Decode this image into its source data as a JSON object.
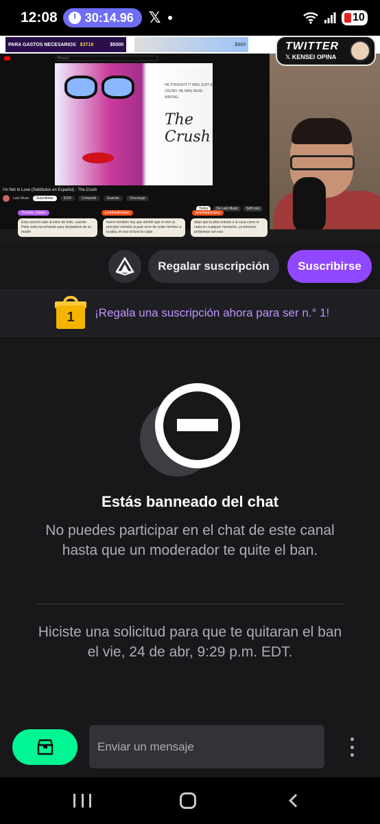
{
  "status_bar": {
    "time": "12:08",
    "timer": "30:14.96",
    "x_symbol": "𝕏",
    "battery": "10",
    "icons": [
      "stopwatch-icon",
      "x-app-icon",
      "notification-dot-icon",
      "wifi-icon",
      "signal-icon",
      "battery-icon"
    ]
  },
  "stream": {
    "ticker_left_text": "PARA GASTOS NECESARIOS",
    "ticker_left_amount": "$3719",
    "ticker_left_amount2": "$5000",
    "ticker_right_amount": "$969",
    "youtube_search_placeholder": "Buscar",
    "poster_title": "The Crush",
    "poster_tagline": "HE THOUGHT IT WAS JUST A CRUSH. HE WAS DEAD WRONG.",
    "video_title": "I'm Not In Love (Subtítulos en Español) - The Crush",
    "channel_name": "Lalo Music",
    "subscribe_label": "Suscribirse",
    "like_count": "3154",
    "share_label": "Compartir",
    "save_label": "Guardar",
    "download_label": "Descargar",
    "chips": [
      "Todos",
      "De Lalo Music",
      "Soft rock"
    ],
    "twitter_badge_title": "TWITTER",
    "twitter_badge_handle": "𝕏 KENSEI OPINA",
    "overlay_messages": [
      {
        "name": "Thunder_Elgato",
        "text": "Esta canción sale al inicio de todo, cuando Peter está escuchando para despedirse de su madre"
      },
      {
        "name": "jonathanjimojuin",
        "text": "bueno tambien hay que admitir que el men al principio cometio al gran error de ceder termino a la piba, en eso el tuvo la culpa"
      },
      {
        "name": "jonathanjimojuin",
        "text": "dejar que la piba entrara a la casa como si nada en cualquier momento, ya tenemos problemas con eso"
      }
    ]
  },
  "actions": {
    "gift_sub_label": "Regalar suscripción",
    "subscribe_label": "Suscribirse",
    "accent_color": "#9147ff"
  },
  "gift_banner": {
    "badge_number": "1",
    "text": "¡Regala una suscripción ahora para ser n.° 1!"
  },
  "ban": {
    "title": "Estás banneado del chat",
    "message": "No puedes participar en el chat de este canal hasta que un moderador te quite el ban.",
    "unban_request": "Hiciste una solicitud para que te quitaran el ban el vie, 24 de abr, 9:29 p.m. EDT."
  },
  "chat_input": {
    "placeholder": "Enviar un mensaje",
    "inventory_color": "#00f593"
  }
}
